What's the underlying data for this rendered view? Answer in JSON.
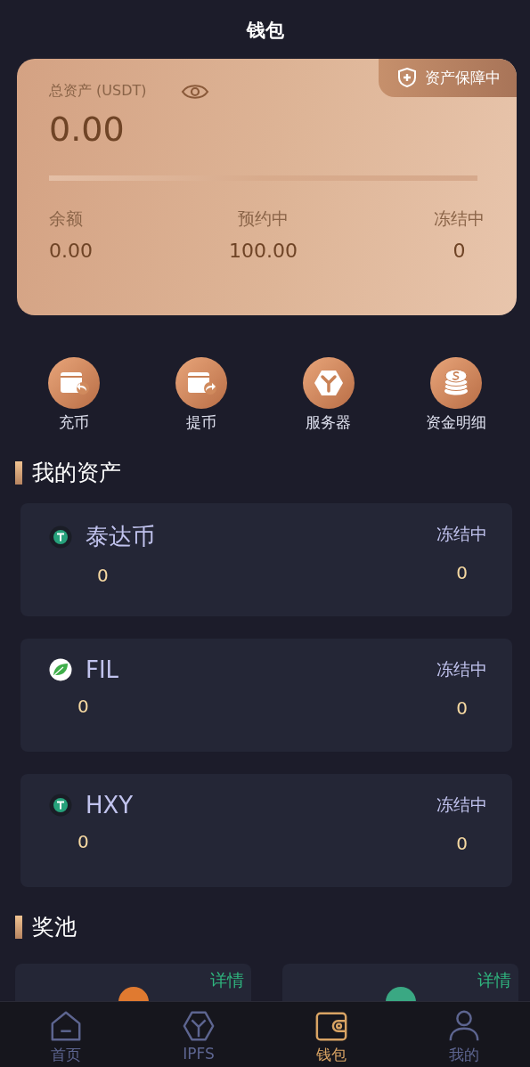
{
  "header": {
    "title": "钱包"
  },
  "summary": {
    "label": "总资产 (USDT)",
    "badge": "资产保障中",
    "total": "0.00",
    "stats": [
      {
        "label": "余额",
        "value": "0.00"
      },
      {
        "label": "预约中",
        "value": "100.00"
      },
      {
        "label": "冻结中",
        "value": "0"
      }
    ]
  },
  "actions": [
    {
      "kind": "deposit",
      "label": "充币"
    },
    {
      "kind": "withdraw",
      "label": "提币"
    },
    {
      "kind": "server",
      "label": "服务器"
    },
    {
      "kind": "coins",
      "label": "资金明细"
    }
  ],
  "assets": {
    "title": "我的资产",
    "items": [
      {
        "kind": "tether",
        "name": "泰达币",
        "amount": "0",
        "frozen_label": "冻结中",
        "frozen": "0"
      },
      {
        "kind": "leaf",
        "name": "FIL",
        "amount": "0",
        "frozen_label": "冻结中",
        "frozen": "0"
      },
      {
        "kind": "tether",
        "name": "HXY",
        "amount": "0",
        "frozen_label": "冻结中",
        "frozen": "0"
      }
    ]
  },
  "pool": {
    "title": "奖池",
    "items": [
      {
        "link": "详情",
        "color": "#e07a30"
      },
      {
        "link": "详情",
        "color": "#3aa883"
      }
    ]
  },
  "tabbar": [
    {
      "kind": "home",
      "label": "首页",
      "selected": false
    },
    {
      "kind": "ipfs",
      "label": "IPFS",
      "selected": false
    },
    {
      "kind": "wallet",
      "label": "钱包",
      "selected": true
    },
    {
      "kind": "user",
      "label": "我的",
      "selected": false
    }
  ]
}
